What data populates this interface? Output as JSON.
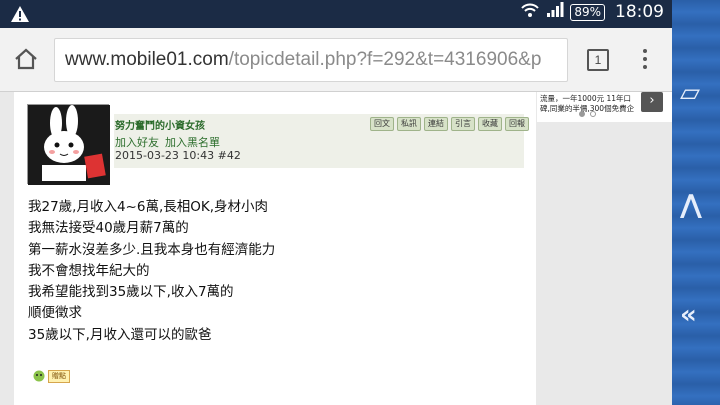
{
  "statusbar": {
    "battery": "89%",
    "time": "18:09"
  },
  "browser": {
    "url_host": "www.mobile01.com",
    "url_path": "/topicdetail.php?f=292&t=4316906&p",
    "tab_count": "1"
  },
  "post": {
    "author_name": "努力奮鬥的小資女孩",
    "add_friend": "加入好友",
    "add_blacklist": "加入黑名單",
    "datetime": "2015-03-23 10:43",
    "floor": "#42",
    "actions": [
      "回文",
      "私訊",
      "連結",
      "引言",
      "收藏",
      "回報"
    ],
    "lines": [
      "我27歲,月收入4~6萬,長相OK,身材小肉",
      "我無法接受40歲月薪7萬的",
      "第一薪水沒差多少.且我本身也有經濟能力",
      "我不會想找年紀大的",
      "我希望能找到35歲以下,收入7萬的",
      "順便徵求",
      "35歲以下,月收入還可以的歐爸"
    ],
    "reward_label": "贈點"
  },
  "ad": {
    "line1": "流量，一年1000元 11年口",
    "line2": "碑,同業的半價,300個免費企",
    "arrow": "›"
  }
}
